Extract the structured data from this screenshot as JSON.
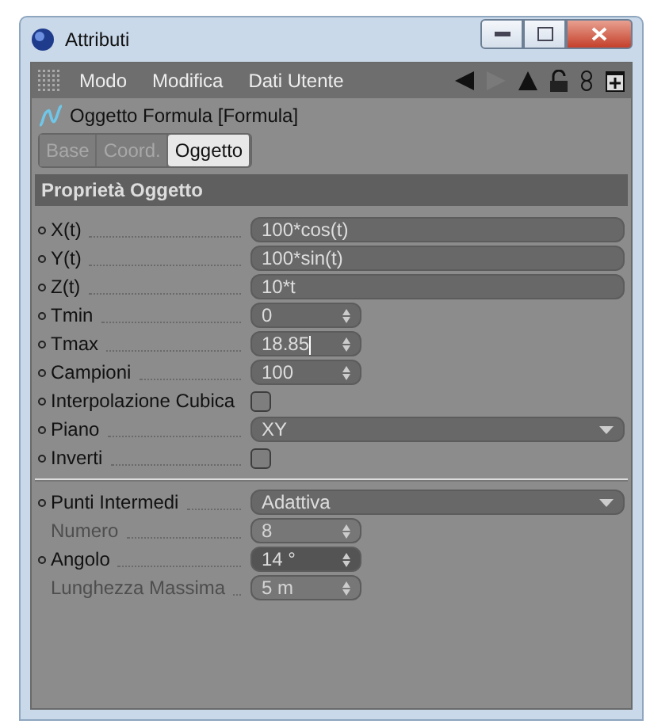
{
  "window": {
    "title": "Attributi"
  },
  "menu": [
    "Modo",
    "Modifica",
    "Dati Utente"
  ],
  "object": {
    "title": "Oggetto Formula [Formula]"
  },
  "tabs": [
    {
      "label": "Base",
      "selected": false
    },
    {
      "label": "Coord.",
      "selected": false
    },
    {
      "label": "Oggetto",
      "selected": true
    }
  ],
  "section": {
    "title": "Proprietà Oggetto"
  },
  "rows": [
    {
      "kind": "text",
      "label": "X(t)",
      "value": "100*cos(t)",
      "disabled": false
    },
    {
      "kind": "text",
      "label": "Y(t)",
      "value": "100*sin(t)",
      "disabled": false
    },
    {
      "kind": "text",
      "label": "Z(t)",
      "value": "10*t",
      "disabled": false
    },
    {
      "kind": "number",
      "label": "Tmin",
      "value": "0",
      "disabled": false,
      "editing": false,
      "highlighted": false
    },
    {
      "kind": "number",
      "label": "Tmax",
      "value": "18.85",
      "disabled": false,
      "editing": true,
      "highlighted": false
    },
    {
      "kind": "number",
      "label": "Campioni",
      "value": "100",
      "disabled": false,
      "editing": false,
      "highlighted": false
    },
    {
      "kind": "checkbox",
      "label": "Interpolazione Cubica",
      "checked": false,
      "disabled": false
    },
    {
      "kind": "dropdown",
      "label": "Piano",
      "value": "XY",
      "disabled": false
    },
    {
      "kind": "checkbox",
      "label": "Inverti",
      "checked": false,
      "disabled": false
    },
    {
      "kind": "separator"
    },
    {
      "kind": "dropdown",
      "label": "Punti Intermedi",
      "value": "Adattiva",
      "disabled": false
    },
    {
      "kind": "number",
      "label": "Numero",
      "value": "8",
      "disabled": true,
      "editing": false,
      "highlighted": false
    },
    {
      "kind": "number",
      "label": "Angolo",
      "value": "14 °",
      "disabled": false,
      "editing": false,
      "highlighted": true
    },
    {
      "kind": "number",
      "label": "Lunghezza Massima",
      "value": "5 m",
      "disabled": true,
      "editing": false,
      "highlighted": false
    }
  ]
}
